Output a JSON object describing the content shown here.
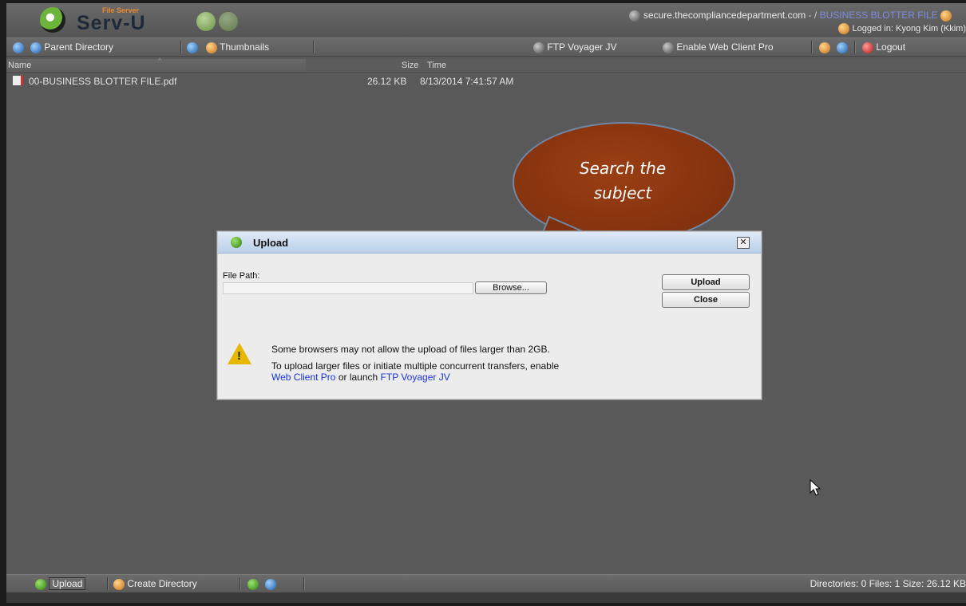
{
  "header": {
    "logo_small": "File Server",
    "logo_text": "Serv-U",
    "host": "secure.thecompliancedepartment.com",
    "path_sep": "- /",
    "current_dir": "BUSINESS BLOTTER FILE",
    "logged_in": "Logged in: Kyong Kim (Kkim)"
  },
  "toolbar": {
    "parent_directory": "Parent Directory",
    "thumbnails": "Thumbnails",
    "ftp_voyager": "FTP Voyager JV",
    "enable_web_client": "Enable Web Client Pro",
    "logout": "Logout"
  },
  "file_list": {
    "columns": {
      "name": "Name",
      "size": "Size",
      "time": "Time"
    },
    "rows": [
      {
        "name": "00-BUSINESS BLOTTER FILE.pdf",
        "size": "26.12 KB",
        "time": "8/13/2014 7:41:57 AM"
      }
    ]
  },
  "dialog": {
    "title": "Upload",
    "close_glyph": "✕",
    "file_path_label": "File Path:",
    "browse_label": "Browse...",
    "upload_label": "Upload",
    "close_label": "Close",
    "warning_text": "Some browsers may not allow the upload of files larger than 2GB.",
    "info_text_1": "To upload larger files or initiate multiple concurrent transfers, enable",
    "link_web_client": "Web Client Pro",
    "info_or_launch": "or launch",
    "link_ftp_voyager": "FTP Voyager JV"
  },
  "callout": {
    "line1": "Search the",
    "line2": "subject"
  },
  "statusbar": {
    "upload": "Upload",
    "create_directory": "Create Directory",
    "summary": "Directories: 0   Files: 1   Size: 26.12 KB"
  },
  "colors": {
    "app_background": "#595959",
    "dialog_background": "#ececec",
    "callout_fill": "#8b3612",
    "link_blue": "#1a33d6",
    "directory_link": "#7d8ce0"
  },
  "icons": [
    "serv-u-logo-icon",
    "back-icon",
    "forward-icon",
    "home-icon",
    "info-icon",
    "refresh-icon",
    "thumbnails-icon",
    "ftp-voyager-icon",
    "web-client-icon",
    "settings-icon",
    "help-icon",
    "logout-icon",
    "pdf-file-icon",
    "upload-icon",
    "warning-icon",
    "create-directory-icon",
    "search-icon",
    "mouse-cursor-icon"
  ]
}
